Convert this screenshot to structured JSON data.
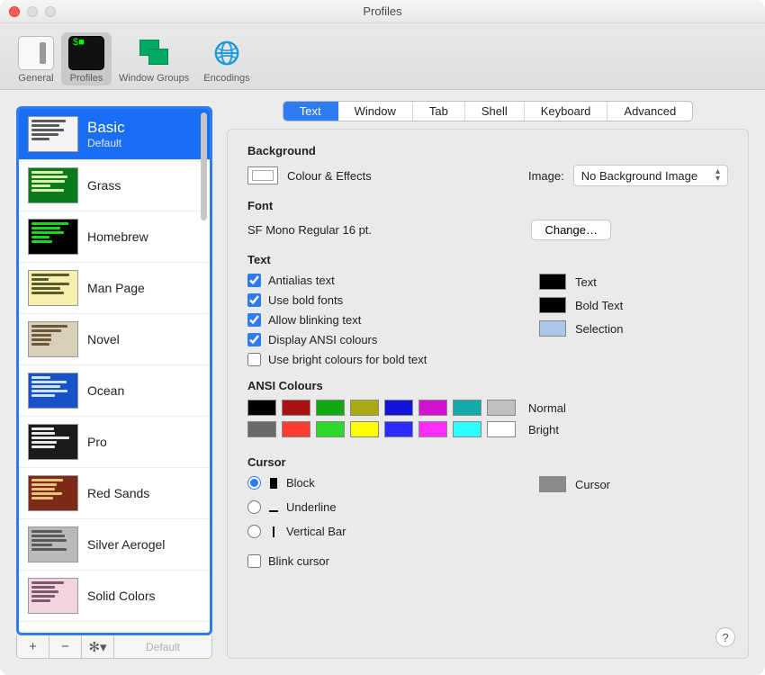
{
  "window": {
    "title": "Profiles"
  },
  "toolbar": {
    "items": [
      {
        "label": "General"
      },
      {
        "label": "Profiles"
      },
      {
        "label": "Window Groups"
      },
      {
        "label": "Encodings"
      }
    ],
    "active_index": 1
  },
  "sidebar": {
    "footer_default_label": "Default",
    "profiles": [
      {
        "name": "Basic",
        "subtitle": "Default",
        "bg": "#f4f4f4",
        "line": "#5a5a5a",
        "selected": true
      },
      {
        "name": "Grass",
        "bg": "#0a7a1f",
        "line": "#d8f0a8"
      },
      {
        "name": "Homebrew",
        "bg": "#000000",
        "line": "#17d817"
      },
      {
        "name": "Man Page",
        "bg": "#f6efb0",
        "line": "#5a5a2d"
      },
      {
        "name": "Novel",
        "bg": "#d9cfb8",
        "line": "#6a5a3a"
      },
      {
        "name": "Ocean",
        "bg": "#1752c8",
        "line": "#cfe3ff"
      },
      {
        "name": "Pro",
        "bg": "#1a1a1a",
        "line": "#e8e8e8"
      },
      {
        "name": "Red Sands",
        "bg": "#7c2b18",
        "line": "#e8c27c"
      },
      {
        "name": "Silver Aerogel",
        "bg": "#b9b9b9",
        "line": "#5a5a5a"
      },
      {
        "name": "Solid Colors",
        "bg": "#f3d3e0",
        "line": "#7c5a6a"
      }
    ]
  },
  "tabs": {
    "items": [
      "Text",
      "Window",
      "Tab",
      "Shell",
      "Keyboard",
      "Advanced"
    ],
    "active_index": 0
  },
  "sections": {
    "background": {
      "heading": "Background",
      "colour_effects_label": "Colour & Effects",
      "image_label": "Image:",
      "image_value": "No Background Image"
    },
    "font": {
      "heading": "Font",
      "value": "SF Mono Regular 16 pt.",
      "change_label": "Change…"
    },
    "text": {
      "heading": "Text",
      "checks": [
        {
          "label": "Antialias text",
          "checked": true
        },
        {
          "label": "Use bold fonts",
          "checked": true
        },
        {
          "label": "Allow blinking text",
          "checked": true
        },
        {
          "label": "Display ANSI colours",
          "checked": true
        },
        {
          "label": "Use bright colours for bold text",
          "checked": false
        }
      ],
      "swatches": [
        {
          "label": "Text",
          "color": "#000000"
        },
        {
          "label": "Bold Text",
          "color": "#000000"
        },
        {
          "label": "Selection",
          "color": "#a9c7e8"
        }
      ]
    },
    "ansi": {
      "heading": "ANSI Colours",
      "normal_label": "Normal",
      "bright_label": "Bright",
      "normal": [
        "#000000",
        "#aa1212",
        "#12a912",
        "#a9a912",
        "#1212d8",
        "#d212d2",
        "#12a9a9",
        "#bfbfbf"
      ],
      "bright": [
        "#6a6a6a",
        "#ff3b30",
        "#2bd82b",
        "#ffff00",
        "#2b2bff",
        "#ff2bff",
        "#2bffff",
        "#ffffff"
      ]
    },
    "cursor": {
      "heading": "Cursor",
      "options": [
        {
          "label": "Block",
          "selected": true
        },
        {
          "label": "Underline",
          "selected": false
        },
        {
          "label": "Vertical Bar",
          "selected": false
        }
      ],
      "blink_label": "Blink cursor",
      "blink_checked": false,
      "swatch_label": "Cursor",
      "swatch_color": "#8a8a8a"
    }
  }
}
